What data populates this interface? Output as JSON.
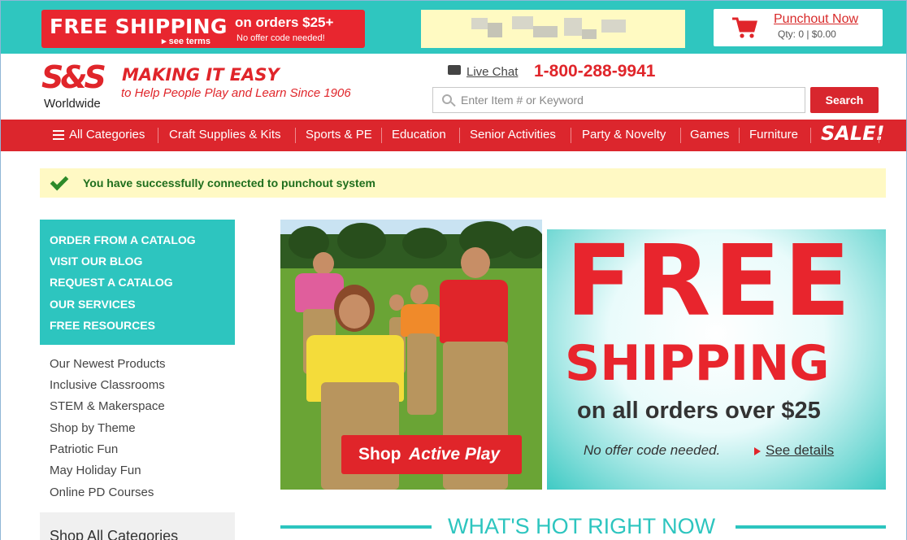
{
  "topbar": {
    "promo_big": "FREE SHIPPING",
    "promo_terms": "▸ see terms",
    "promo_side1": "on orders $25+",
    "promo_side2": "No offer code needed!",
    "cart_link": "Punchout Now",
    "cart_qty": "Qty: 0 | $0.00",
    "cart_icon": "shopping-cart-icon"
  },
  "header": {
    "logo_text": "S&S",
    "logo_sub": "Worldwide",
    "tagline_main": "MAKING IT EASY",
    "tagline_sub": "to Help People Play and Learn Since 1906",
    "chat_label": "Live Chat",
    "phone": "1-800-288-9941",
    "search_placeholder": "Enter Item # or Keyword",
    "search_button": "Search"
  },
  "nav": {
    "items": [
      "All Categories",
      "Craft Supplies & Kits",
      "Sports & PE",
      "Education",
      "Senior Activities",
      "Party & Novelty",
      "Games",
      "Furniture"
    ],
    "sale": "SALE!"
  },
  "success": {
    "message": "You have successfully connected to punchout system"
  },
  "sidebar": {
    "teal_links": [
      "ORDER FROM A CATALOG",
      "VISIT OUR BLOG",
      "REQUEST A CATALOG",
      "OUR SERVICES",
      "FREE RESOURCES"
    ],
    "links": [
      "Our Newest Products",
      "Inclusive Classrooms",
      "STEM & Makerspace",
      "Shop by Theme",
      "Patriotic Fun",
      "May Holiday Fun",
      "Online PD Courses"
    ],
    "shop_all": "Shop All Categories"
  },
  "hero": {
    "button_a": "Shop",
    "button_b": "Active Play"
  },
  "free_shipping": {
    "big": "FREE",
    "shipping": "SHIPPING",
    "orders": "on all orders over $25",
    "no_code": "No offer code needed.",
    "see_details": "See details"
  },
  "hot": {
    "title": "WHAT'S HOT RIGHT NOW"
  },
  "colors": {
    "brand_red": "#dc262d",
    "teal": "#2dc5bf",
    "success_bg": "#fff9c4"
  }
}
